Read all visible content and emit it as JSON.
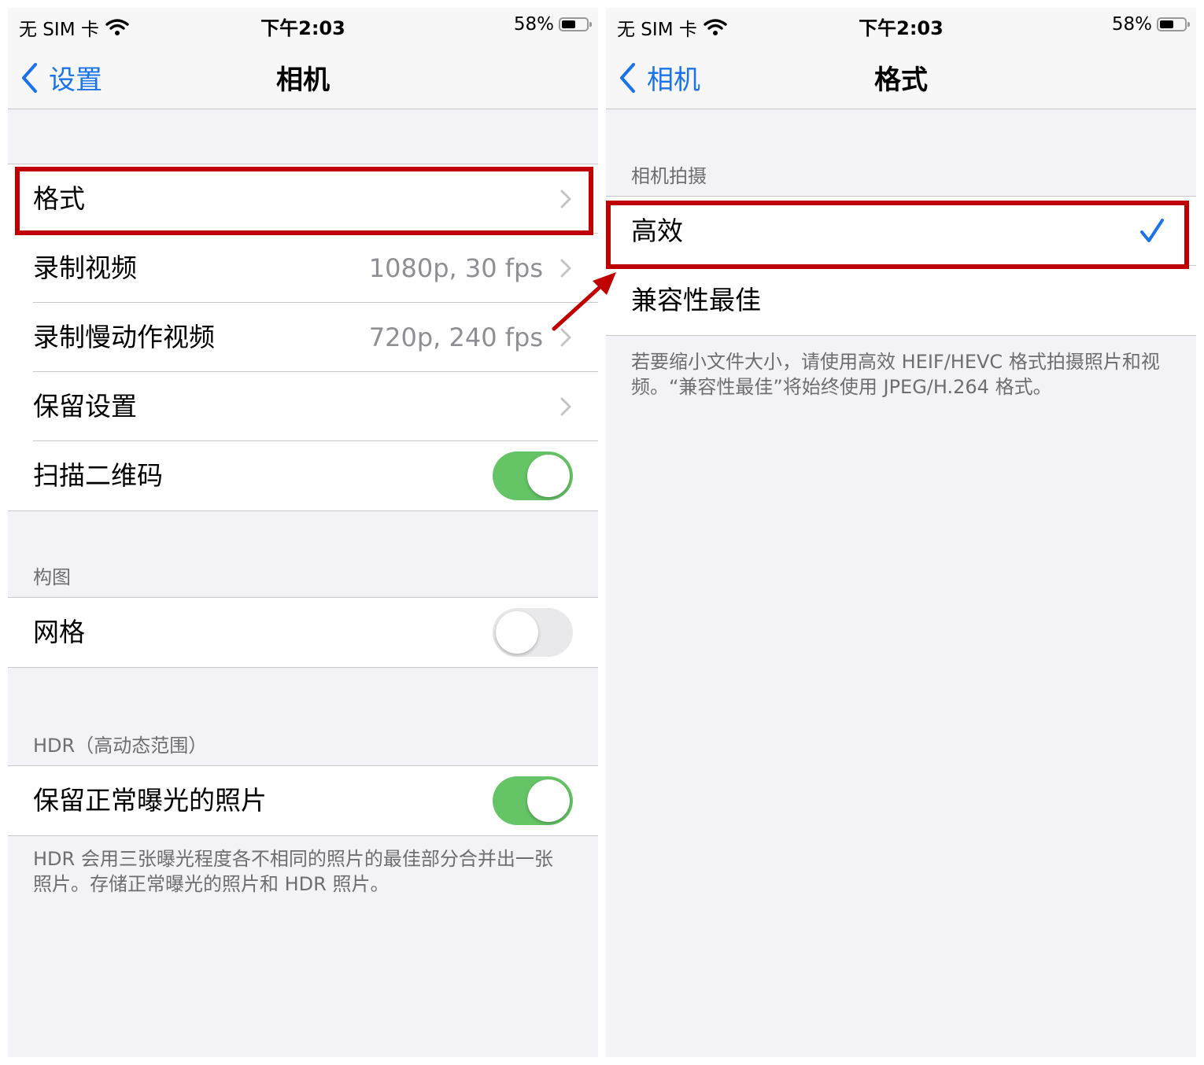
{
  "left_screen": {
    "status": {
      "carrier": "无 SIM 卡",
      "time": "下午2:03",
      "battery": "58%",
      "battery_level": 0.58
    },
    "nav": {
      "back_label": "设置",
      "title": "相机"
    },
    "group1": [
      {
        "label": "格式",
        "value": ""
      },
      {
        "label": "录制视频",
        "value": "1080p, 30 fps"
      },
      {
        "label": "录制慢动作视频",
        "value": "720p, 240 fps"
      },
      {
        "label": "保留设置",
        "value": ""
      },
      {
        "label": "扫描二维码",
        "toggle": true
      }
    ],
    "section_composition": {
      "header": "构图",
      "rows": [
        {
          "label": "网格",
          "toggle": false
        }
      ]
    },
    "section_hdr": {
      "header": "HDR（高动态范围）",
      "rows": [
        {
          "label": "保留正常曝光的照片",
          "toggle": true
        }
      ],
      "footer": "HDR 会用三张曝光程度各不相同的照片的最佳部分合并出一张照片。存储正常曝光的照片和 HDR 照片。"
    }
  },
  "right_screen": {
    "status": {
      "carrier": "无 SIM 卡",
      "time": "下午2:03",
      "battery": "58%",
      "battery_level": 0.58
    },
    "nav": {
      "back_label": "相机",
      "title": "格式"
    },
    "section_capture": {
      "header": "相机拍摄",
      "options": [
        {
          "label": "高效",
          "selected": true
        },
        {
          "label": "兼容性最佳",
          "selected": false
        }
      ],
      "footer": "若要缩小文件大小，请使用高效 HEIF/HEVC 格式拍摄照片和视频。“兼容性最佳”将始终使用 JPEG/H.264 格式。"
    }
  },
  "colors": {
    "accent": "#1a73e8",
    "toggle_on": "#65c466",
    "highlight": "#c00000"
  },
  "icons": [
    "wifi-icon",
    "battery-icon",
    "back-chevron-icon",
    "chevron-right-icon",
    "checkmark-icon",
    "arrow-annotation"
  ]
}
